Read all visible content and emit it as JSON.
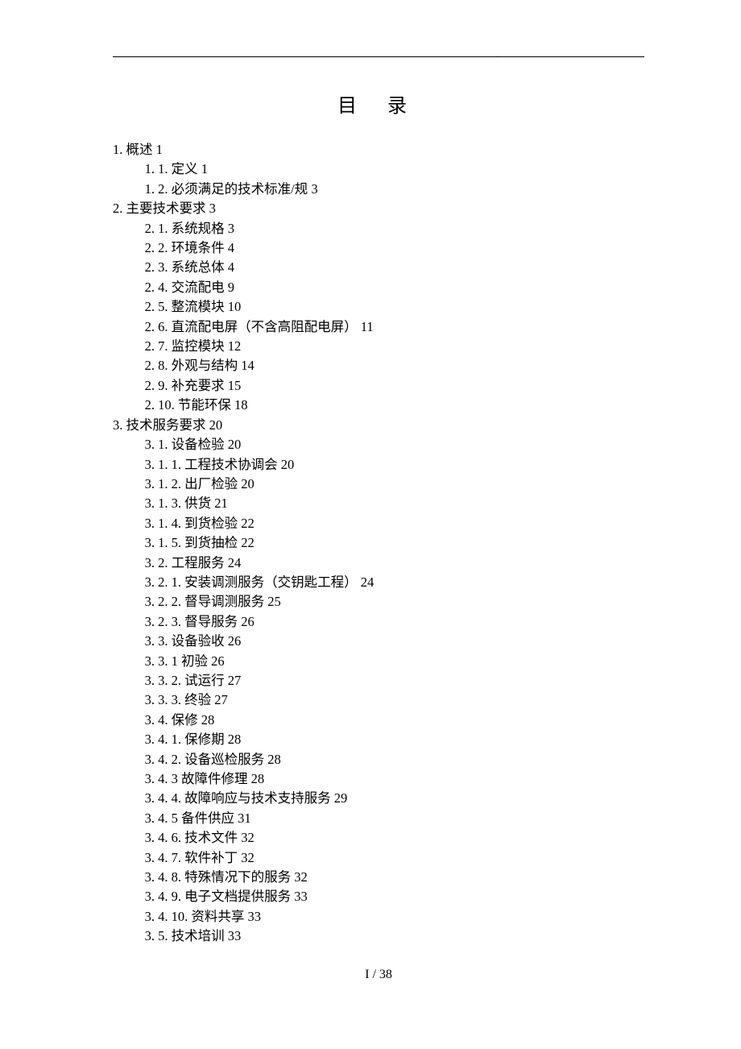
{
  "title": "目 录",
  "footer": "I / 38",
  "toc": [
    {
      "level": 1,
      "text": "1. 概述",
      "page": "1"
    },
    {
      "level": 2,
      "text": "1. 1. 定义",
      "page": "1"
    },
    {
      "level": 2,
      "text": "1. 2. 必须满足的技术标准/规",
      "page": "3"
    },
    {
      "level": 1,
      "text": "2. 主要技术要求",
      "page": "3"
    },
    {
      "level": 2,
      "text": "2. 1. 系统规格",
      "page": "3"
    },
    {
      "level": 2,
      "text": "2. 2. 环境条件",
      "page": "4"
    },
    {
      "level": 2,
      "text": "2. 3. 系统总体",
      "page": "4"
    },
    {
      "level": 2,
      "text": "2. 4. 交流配电",
      "page": "9"
    },
    {
      "level": 2,
      "text": "2. 5. 整流模块",
      "page": "10"
    },
    {
      "level": 2,
      "text": "2. 6. 直流配电屏（不含高阻配电屏）",
      "page": "11"
    },
    {
      "level": 2,
      "text": "2. 7. 监控模块",
      "page": "12"
    },
    {
      "level": 2,
      "text": "2. 8. 外观与结构",
      "page": "14"
    },
    {
      "level": 2,
      "text": "2. 9. 补充要求",
      "page": "15"
    },
    {
      "level": 2,
      "text": "2. 10. 节能环保",
      "page": "18"
    },
    {
      "level": 1,
      "text": "3. 技术服务要求",
      "page": "20"
    },
    {
      "level": 2,
      "text": "3. 1. 设备检验",
      "page": "20"
    },
    {
      "level": 3,
      "text": "3. 1. 1. 工程技术协调会",
      "page": "20"
    },
    {
      "level": 3,
      "text": "3. 1. 2. 出厂检验",
      "page": "20"
    },
    {
      "level": 3,
      "text": "3. 1. 3. 供货",
      "page": "21"
    },
    {
      "level": 3,
      "text": "3. 1. 4. 到货检验",
      "page": "22"
    },
    {
      "level": 3,
      "text": "3. 1. 5. 到货抽检",
      "page": "22"
    },
    {
      "level": 2,
      "text": "3. 2. 工程服务",
      "page": "24"
    },
    {
      "level": 3,
      "text": "3. 2. 1. 安装调测服务（交钥匙工程）",
      "page": "24"
    },
    {
      "level": 3,
      "text": "3. 2. 2. 督导调测服务",
      "page": "25"
    },
    {
      "level": 3,
      "text": "3. 2. 3. 督导服务",
      "page": "26"
    },
    {
      "level": 2,
      "text": "3. 3. 设备验收",
      "page": "26"
    },
    {
      "level": 3,
      "text": "3. 3. 1 初验",
      "page": "26"
    },
    {
      "level": 3,
      "text": "3. 3. 2. 试运行",
      "page": "27"
    },
    {
      "level": 3,
      "text": "3. 3. 3. 终验",
      "page": "27"
    },
    {
      "level": 2,
      "text": "3. 4. 保修",
      "page": "28"
    },
    {
      "level": 3,
      "text": "3. 4. 1. 保修期",
      "page": "28"
    },
    {
      "level": 3,
      "text": "3. 4. 2. 设备巡检服务",
      "page": "28"
    },
    {
      "level": 3,
      "text": "3. 4. 3 故障件修理",
      "page": "28"
    },
    {
      "level": 3,
      "text": "3. 4. 4. 故障响应与技术支持服务",
      "page": "29"
    },
    {
      "level": 3,
      "text": "3. 4. 5 备件供应",
      "page": "31"
    },
    {
      "level": 3,
      "text": "3. 4. 6. 技术文件",
      "page": "32"
    },
    {
      "level": 3,
      "text": "3. 4. 7. 软件补丁",
      "page": "32"
    },
    {
      "level": 3,
      "text": "3. 4. 8. 特殊情况下的服务",
      "page": "32"
    },
    {
      "level": 3,
      "text": "3. 4. 9. 电子文档提供服务",
      "page": "33"
    },
    {
      "level": 3,
      "text": "3. 4. 10. 资料共享",
      "page": "33"
    },
    {
      "level": 2,
      "text": "3. 5. 技术培训",
      "page": "33"
    }
  ]
}
